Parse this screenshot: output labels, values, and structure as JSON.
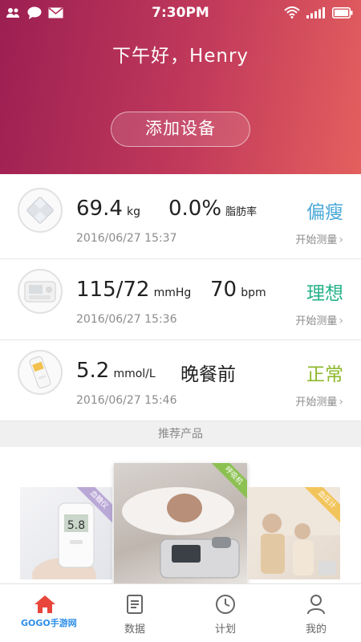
{
  "status_bar": {
    "time": "7:30PM"
  },
  "header": {
    "greeting": "下午好，Henry",
    "add_device_label": "添加设备"
  },
  "devices": [
    {
      "icon": "scale-icon",
      "value1": "69.4",
      "unit1": "kg",
      "value2": "0.0%",
      "label2": "脂肪率",
      "timestamp": "2016/06/27 15:37",
      "status": "偏瘦",
      "status_color": "#4aa8d8",
      "action": "开始测量"
    },
    {
      "icon": "blood-pressure-monitor-icon",
      "value1": "115/72",
      "unit1": "mmHg",
      "value2": "70",
      "unit2": "bpm",
      "timestamp": "2016/06/27 15:36",
      "status": "理想",
      "status_color": "#27b38a",
      "action": "开始测量"
    },
    {
      "icon": "glucose-meter-icon",
      "value1": "5.2",
      "unit1": "mmol/L",
      "value2": "晚餐前",
      "timestamp": "2016/06/27 15:46",
      "status": "正常",
      "status_color": "#8cb82a",
      "action": "开始测量"
    }
  ],
  "recommended": {
    "title": "推荐产品",
    "cards": [
      {
        "ribbon": "血糖仪",
        "display": "5.8"
      },
      {
        "ribbon": "呼吸机"
      },
      {
        "ribbon": "血压计"
      }
    ]
  },
  "tabs": [
    {
      "label": "",
      "icon": "home-icon",
      "active": true
    },
    {
      "label": "数据",
      "icon": "data-icon"
    },
    {
      "label": "计划",
      "icon": "clock-icon"
    },
    {
      "label": "我的",
      "icon": "profile-icon"
    }
  ],
  "watermark": "GOGO手游网",
  "colors": {
    "brand": "#c23a5b",
    "active_tab": "#e8463b"
  }
}
